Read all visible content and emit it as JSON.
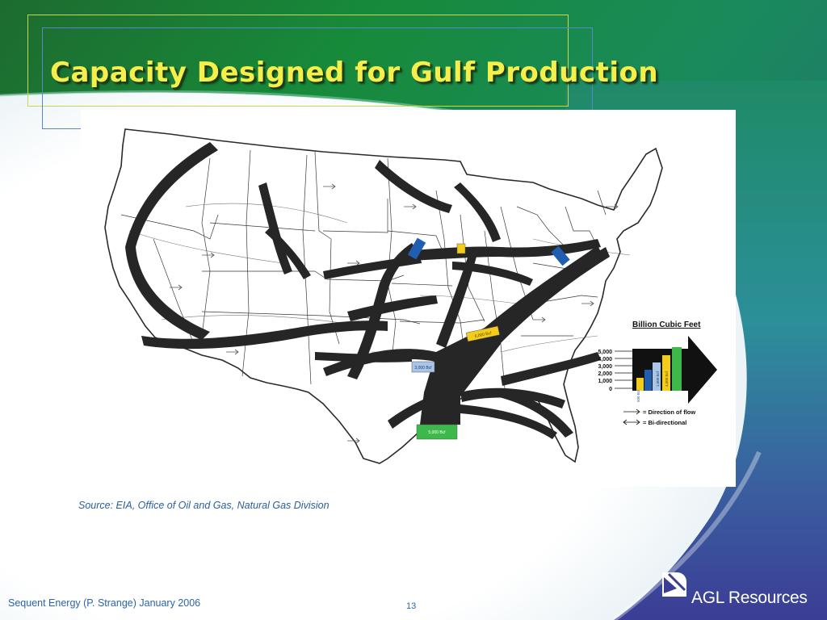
{
  "slide": {
    "title": "Capacity Designed for Gulf Production",
    "source": "Source: EIA, Office of Oil and Gas, Natural Gas Division",
    "footer": "Sequent Energy (P. Strange) January 2006",
    "page_number": "13"
  },
  "logo": {
    "text": "AGL Resources"
  },
  "map": {
    "labels": [
      {
        "text": "6,000 Bcf",
        "color": "#f3cc1c",
        "text_color": "#5a4a00"
      },
      {
        "text": "3,000 Bcf",
        "color": "#a9c6e8",
        "text_color": "#1f3d6b"
      },
      {
        "text": "5,000 Bcf",
        "color": "#3cb94a",
        "text_color": "#ffffff"
      }
    ]
  },
  "legend": {
    "title": "Billion Cubic Feet",
    "scale": [
      "5,000",
      "4,000",
      "3,000",
      "2,000",
      "1,000",
      "0"
    ],
    "bar_labels": [
      "500 Bcf",
      "1,000 Bcf",
      "4,000 Bcf"
    ],
    "direction": "=  Direction of flow",
    "bidirectional": "=  Bi-directional"
  },
  "colors": {
    "title": "#f4ef4a",
    "flow": "#262626",
    "yellow": "#f3cc1c",
    "blue": "#1f5eb0",
    "green": "#3cb94a"
  }
}
